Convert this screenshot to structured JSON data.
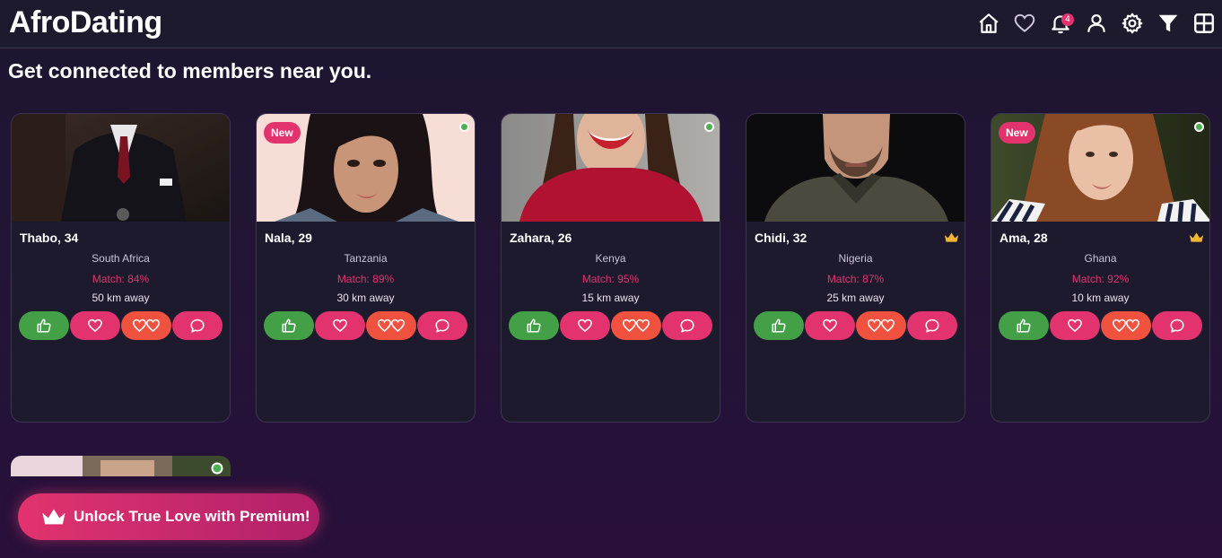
{
  "app": {
    "title": "AfroDating"
  },
  "nav": {
    "icons": [
      "home-icon",
      "heart-icon",
      "bell-icon",
      "user-icon",
      "gear-icon",
      "filter-icon",
      "grid-icon"
    ],
    "notification_count": "4"
  },
  "headline": "Get connected to members near you.",
  "colors": {
    "accent": "#e2336f",
    "like": "#43a047",
    "superlike": "#f1513f",
    "online": "#4caf50",
    "premium_crown": "#f2b632"
  },
  "members": [
    {
      "name": "Thabo, 34",
      "country": "South Africa",
      "match": "Match: 84%",
      "distance": "50 km away",
      "is_new": false,
      "online": false,
      "premium": false
    },
    {
      "name": "Nala, 29",
      "country": "Tanzania",
      "match": "Match: 89%",
      "distance": "30 km away",
      "is_new": true,
      "new_label": "New",
      "online": true,
      "premium": false
    },
    {
      "name": "Zahara, 26",
      "country": "Kenya",
      "match": "Match: 95%",
      "distance": "15 km away",
      "is_new": false,
      "online": true,
      "premium": false
    },
    {
      "name": "Chidi, 32",
      "country": "Nigeria",
      "match": "Match: 87%",
      "distance": "25 km away",
      "is_new": false,
      "online": false,
      "premium": true
    },
    {
      "name": "Ama, 28",
      "country": "Ghana",
      "match": "Match: 92%",
      "distance": "10 km away",
      "is_new": true,
      "new_label": "New",
      "online": true,
      "premium": true
    }
  ],
  "premium_button": {
    "label": "Unlock True Love with Premium!"
  }
}
